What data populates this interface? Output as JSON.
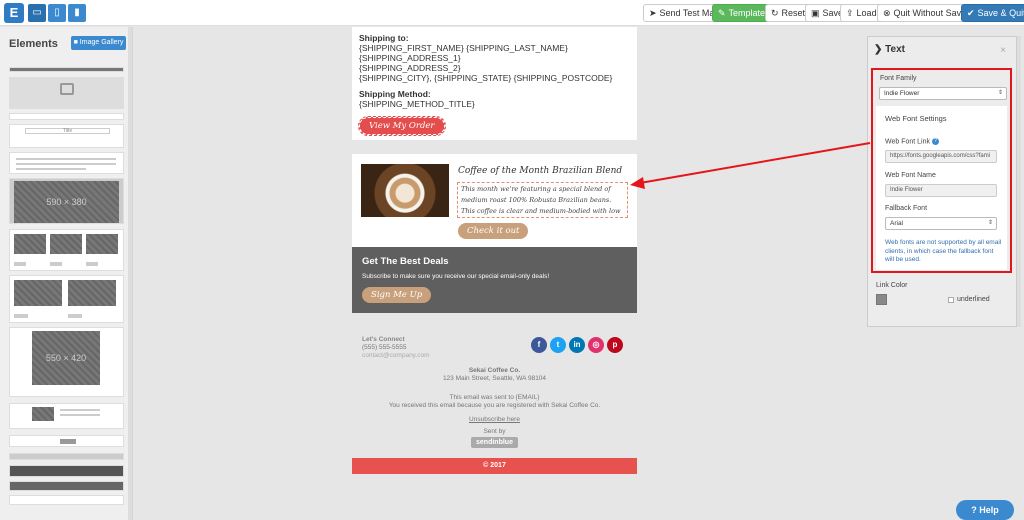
{
  "toolbar": {
    "logo_glyph": "E",
    "device_buttons": [
      "desktop-icon",
      "tablet-icon",
      "mobile-icon"
    ],
    "send_test": "Send Test Mail",
    "templates": "Templates",
    "reset": "Reset",
    "save": "Save",
    "load": "Load",
    "quit_without_saving": "Quit Without Saving",
    "save_quit": "Save & Quit"
  },
  "left_panel": {
    "title": "Elements",
    "gallery_button": "Image Gallery",
    "thumbs": {
      "t1_text": "Title",
      "big1": "590 × 380",
      "big2": "550 × 420"
    }
  },
  "email": {
    "shipping_to_heading": "Shipping to:",
    "shipping_lines": [
      "{SHIPPING_FIRST_NAME} {SHIPPING_LAST_NAME}",
      "{SHIPPING_ADDRESS_1}",
      "{SHIPPING_ADDRESS_2}",
      "{SHIPPING_CITY}, {SHIPPING_STATE} {SHIPPING_POSTCODE}"
    ],
    "shipping_method_heading": "Shipping Method:",
    "shipping_method_value": "{SHIPPING_METHOD_TITLE}",
    "view_order_button": "View My Order",
    "product_title": "Coffee of the Month Brazilian Blend",
    "product_text": "This month we're featuring a special blend of medium roast 100% Robusta Brazilian beans. This coffee is clear and medium-bodied with low acidity.",
    "check_it_out": "Check it out",
    "deals_title": "Get The Best Deals",
    "deals_text": "Subscribe to make sure you receive our special email-only deals!",
    "sign_me_up": "Sign Me Up",
    "lets_connect": "Let's Connect",
    "phone": "(555) 555-5555",
    "email_addr": "contact@company.com",
    "socials": [
      {
        "icon": "facebook-icon",
        "glyph": "f",
        "color": "#3b5998"
      },
      {
        "icon": "twitter-icon",
        "glyph": "t",
        "color": "#1da1f2"
      },
      {
        "icon": "linkedin-icon",
        "glyph": "in",
        "color": "#0077b5"
      },
      {
        "icon": "instagram-icon",
        "glyph": "◎",
        "color": "#e1306c"
      },
      {
        "icon": "pinterest-icon",
        "glyph": "p",
        "color": "#bd081c"
      }
    ],
    "company": "Sekai Coffee Co.",
    "address": "123 Main Street, Seattle, WA 98104",
    "sent_to": "This email was sent to {EMAIL}",
    "registered": "You received this email because you are registered with Sekai Coffee Co.",
    "unsubscribe": "Unsubscribe here",
    "sent_by": "Sent by",
    "brand": "sendinblue",
    "copyright": "© 2017"
  },
  "right_panel": {
    "title": "Text",
    "close": "×",
    "font_family_label": "Font Family",
    "font_family_value": "Indie Flower",
    "web_font_settings": "Web Font Settings",
    "web_font_link_label": "Web Font Link",
    "web_font_link_value": "https://fonts.googleapis.com/css?fami",
    "web_font_name_label": "Web Font Name",
    "web_font_name_value": "Indie Flower",
    "fallback_label": "Fallback Font",
    "fallback_value": "Arial",
    "note": "Web fonts are not supported by all email clients, in which case the fallback font will be used.",
    "link_color_label": "Link Color",
    "underlined_label": "underlined"
  },
  "help": "Help",
  "colors": {
    "accent": "#3b8ad0",
    "highlight_red": "#e5161b",
    "footer_bar": "#e8524e",
    "deals_bg": "#5f5f5f"
  }
}
